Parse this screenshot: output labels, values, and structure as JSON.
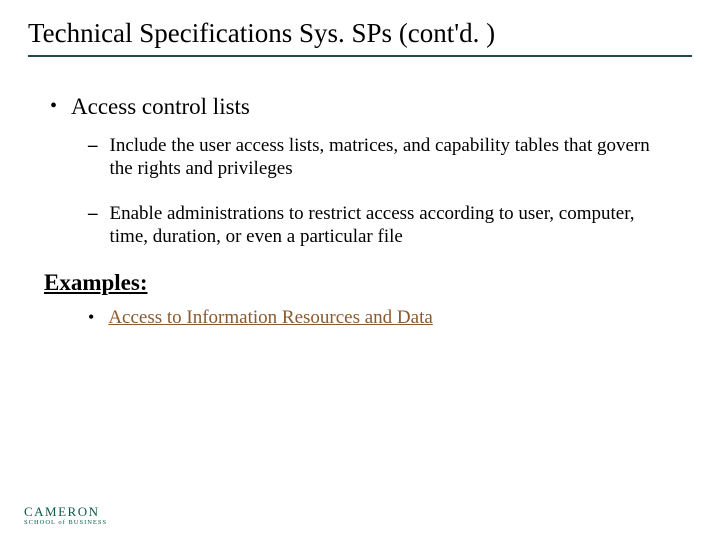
{
  "title": "Technical Specifications Sys. SPs (cont'd. )",
  "bullet_main": "Access control lists",
  "sub1": "Include the user access lists, matrices, and capability tables that govern the rights and privileges",
  "sub2": "Enable administrations to restrict access according to user, computer, time, duration, or even a particular file",
  "examples_heading": "Examples:",
  "example_link": "Access to Information Resources and Data",
  "logo": {
    "main": "CAMERON",
    "sub": "SCHOOL of BUSINESS"
  }
}
